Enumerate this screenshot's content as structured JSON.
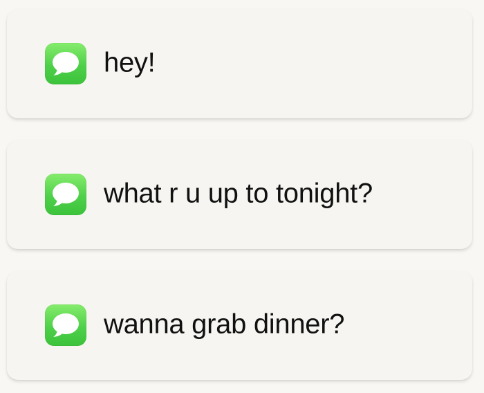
{
  "messages": [
    {
      "icon": "messages-icon",
      "text": "hey!"
    },
    {
      "icon": "messages-icon",
      "text": "what r u up to tonight?"
    },
    {
      "icon": "messages-icon",
      "text": "wanna grab dinner?"
    }
  ],
  "colors": {
    "background": "#f8f7f3",
    "card": "#f6f5f1",
    "icon_green": "#4fd04a",
    "bubble": "#ffffff",
    "text": "#111111"
  }
}
